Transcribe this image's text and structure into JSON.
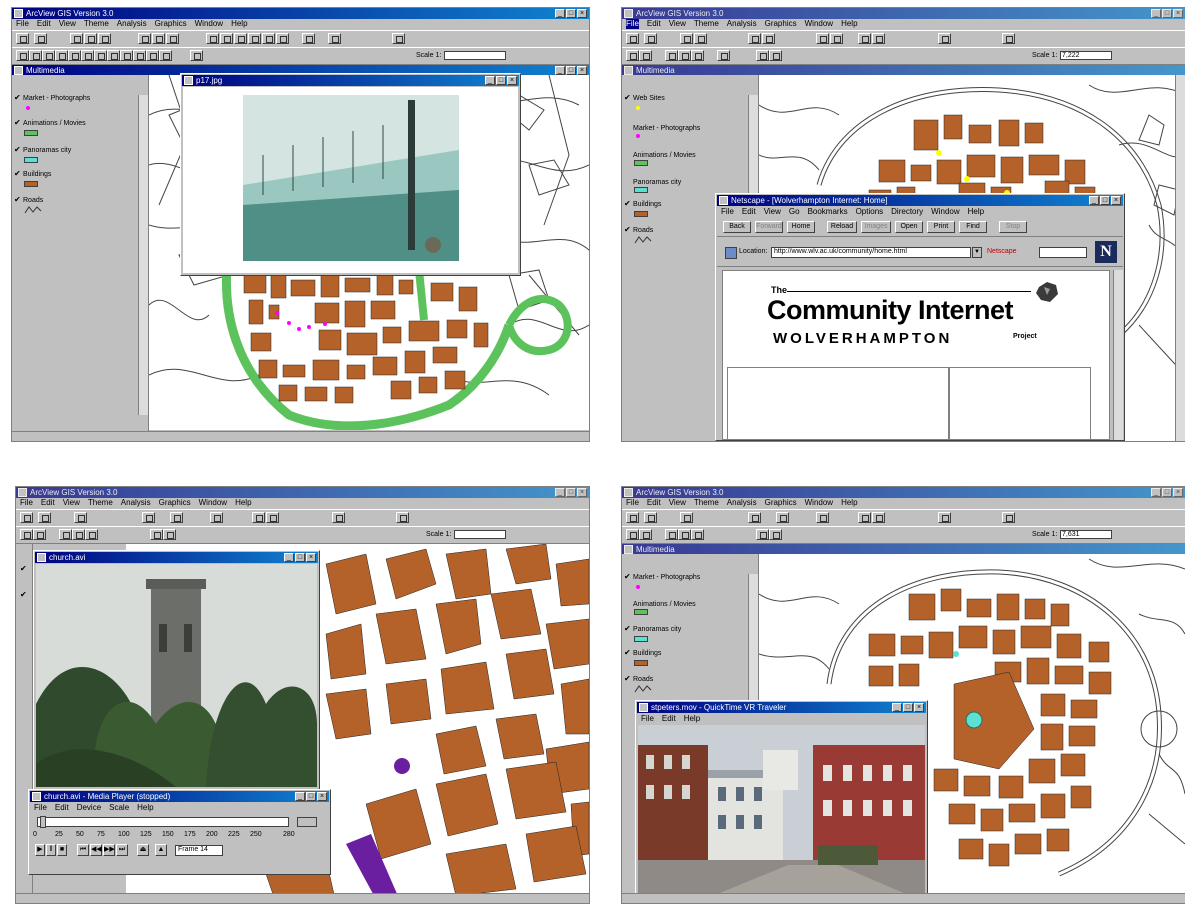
{
  "arcview": {
    "app_title": "ArcView GIS Version 3.0",
    "menu": [
      "File",
      "Edit",
      "View",
      "Theme",
      "Analysis",
      "Graphics",
      "Window",
      "Help"
    ],
    "view_title": "Multimedia",
    "scale_label": "Scale 1:",
    "scale_values": [
      "",
      "7,222",
      "",
      "7,631"
    ]
  },
  "legend": {
    "photographs": "Market - Photographs",
    "animations": "Animations / Movies",
    "panoramas": "Panoramas city",
    "buildings": "Buildings",
    "roads": "Roads",
    "web_sites": "Web Sites"
  },
  "panel1": {
    "photo_title": "p17.jpg"
  },
  "panel2": {
    "browser_title": "Netscape - [Wolverhampton Internet: Home]",
    "menu": [
      "File",
      "Edit",
      "View",
      "Go",
      "Bookmarks",
      "Options",
      "Directory",
      "Window",
      "Help"
    ],
    "buttons": [
      "Back",
      "Forward",
      "Home",
      "Reload",
      "Images",
      "Open",
      "Print",
      "Find",
      "Stop"
    ],
    "location_label": "Location:",
    "url": "http://www.wlv.ac.uk/community/home.html",
    "whats_new": "Netscape",
    "page_the": "The",
    "page_title": "Community Internet",
    "page_city": "WOLVERHAMPTON",
    "page_project": "Project"
  },
  "panel3": {
    "movie_title": "church.avi",
    "player_title": "church.avi - Media Player (stopped)",
    "player_menu": [
      "File",
      "Edit",
      "Device",
      "Scale",
      "Help"
    ],
    "ticks": [
      "0",
      "25",
      "50",
      "75",
      "100",
      "125",
      "150",
      "175",
      "200",
      "225",
      "250",
      "280"
    ],
    "frame_readout": "Frame 14"
  },
  "panel4": {
    "pano_title": "stpeters.mov - QuickTime VR Traveler",
    "pano_menu": [
      "File",
      "Edit",
      "Help"
    ]
  },
  "colors": {
    "buildings": "#b4622a",
    "roads_green": "#5cc35c",
    "titlebar": "#000080",
    "photo_point": "#ff00ff",
    "web_point": "#ffff00",
    "movie_point": "#6a1fa0",
    "pano_point": "#5ce0d0"
  }
}
